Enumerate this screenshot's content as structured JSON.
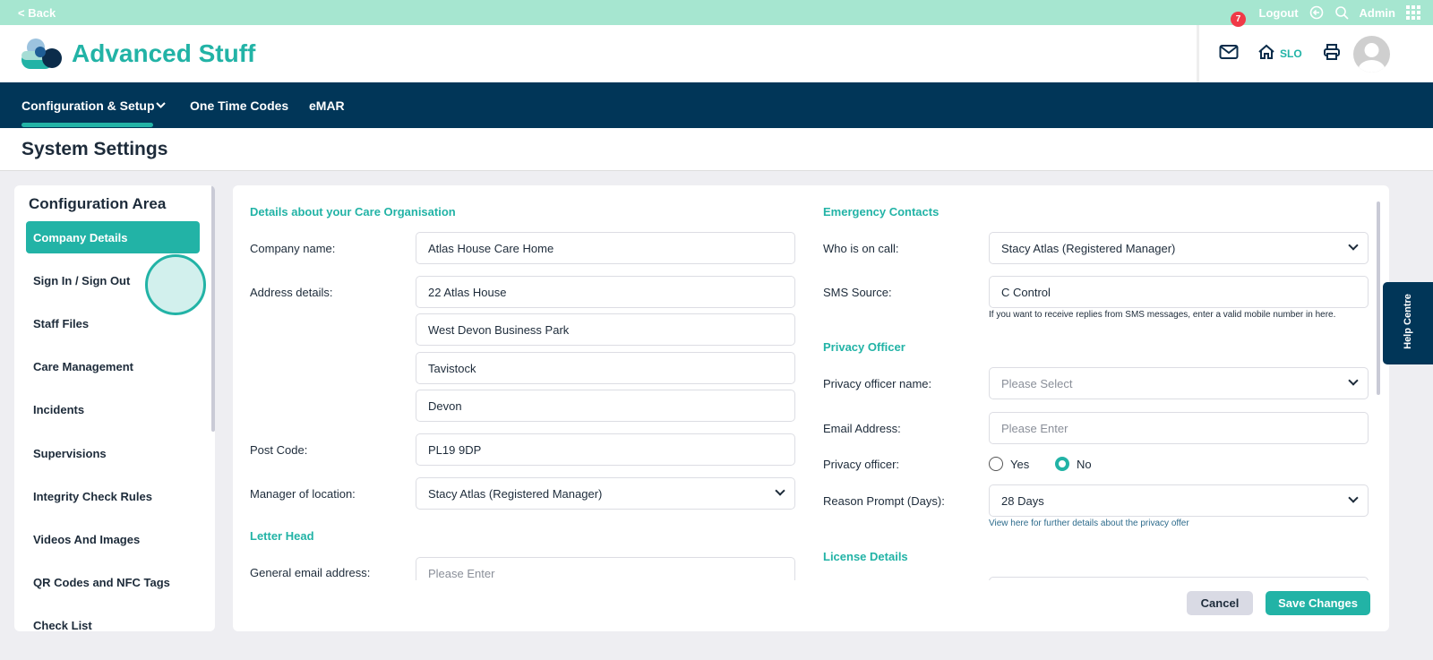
{
  "topbar": {
    "back": "< Back",
    "logout": "Logout",
    "admin": "Admin"
  },
  "header": {
    "brand": "Advanced Stuff",
    "mail_count": "7",
    "home_label": "SLO"
  },
  "nav": {
    "items": [
      "Configuration & Setup",
      "One Time Codes",
      "eMAR"
    ]
  },
  "page_title": "System Settings",
  "sidebar": {
    "title": "Configuration Area",
    "items": [
      "Company Details",
      "Sign In / Sign Out",
      "Staff Files",
      "Care Management",
      "Incidents",
      "Supervisions",
      "Integrity Check Rules",
      "Videos And Images",
      "QR Codes and NFC Tags",
      "Check List"
    ]
  },
  "left": {
    "section": "Details about your Care Organisation",
    "company_label": "Company name:",
    "company": "Atlas House Care Home",
    "address_label": "Address details:",
    "address": [
      "22 Atlas House",
      "West Devon Business Park",
      "Tavistock",
      "Devon"
    ],
    "postcode_label": "Post Code:",
    "postcode": "PL19 9DP",
    "manager_label": "Manager of location:",
    "manager": "Stacy Atlas (Registered Manager)",
    "letterhead": "Letter Head",
    "email_label": "General email address:",
    "email_placeholder": "Please Enter"
  },
  "right": {
    "section": "Emergency Contacts",
    "oncall_label": "Who is on call:",
    "oncall": "Stacy Atlas (Registered Manager)",
    "sms_label": "SMS Source:",
    "sms": "C Control",
    "sms_hint": "If you want to receive replies from SMS messages, enter a valid mobile number in here.",
    "privacy_section": "Privacy Officer",
    "po_name_label": "Privacy officer name:",
    "po_name_placeholder": "Please Select",
    "po_email_label": "Email Address:",
    "po_email_placeholder": "Please Enter",
    "po_label": "Privacy officer:",
    "yes": "Yes",
    "no": "No",
    "reason_label": "Reason Prompt (Days):",
    "reason": "28 Days",
    "privacy_link": "View here for further details about the privacy offer",
    "license_section": "License Details"
  },
  "buttons": {
    "cancel": "Cancel",
    "save": "Save Changes"
  },
  "help": "Help Centre",
  "colors": {
    "accent": "#22b3a6",
    "navy": "#013658",
    "mint": "#a6e6d0"
  }
}
